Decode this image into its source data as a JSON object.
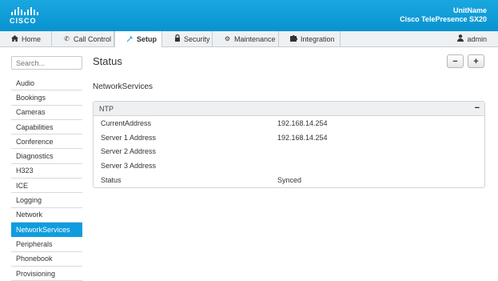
{
  "brand": {
    "logo_text": "CISCO"
  },
  "unit": {
    "name": "UnitName",
    "product": "Cisco TelePresence SX20"
  },
  "nav": {
    "tabs": [
      {
        "label": "Home",
        "icon": "home-icon"
      },
      {
        "label": "Call Control",
        "icon": "phone-icon"
      },
      {
        "label": "Setup",
        "icon": "wrench-icon"
      },
      {
        "label": "Security",
        "icon": "lock-icon"
      },
      {
        "label": "Maintenance",
        "icon": "gear-icon"
      },
      {
        "label": "Integration",
        "icon": "puzzle-icon"
      }
    ],
    "active_tab": "Setup",
    "user": "admin"
  },
  "sidebar": {
    "search_placeholder": "Search...",
    "items": [
      "Audio",
      "Bookings",
      "Cameras",
      "Capabilities",
      "Conference",
      "Diagnostics",
      "H323",
      "ICE",
      "Logging",
      "Network",
      "NetworkServices",
      "Peripherals",
      "Phonebook",
      "Provisioning"
    ],
    "selected": "NetworkServices"
  },
  "main": {
    "title": "Status",
    "collapse_all_label": "−",
    "expand_all_label": "+",
    "section_title": "NetworkServices",
    "panel": {
      "title": "NTP",
      "collapse_label": "−",
      "rows": [
        {
          "key": "CurrentAddress",
          "value": "192.168.14.254"
        },
        {
          "key": "Server 1 Address",
          "value": "192.168.14.254"
        },
        {
          "key": "Server 2 Address",
          "value": ""
        },
        {
          "key": "Server 3 Address",
          "value": ""
        },
        {
          "key": "Status",
          "value": "Synced"
        }
      ]
    }
  }
}
